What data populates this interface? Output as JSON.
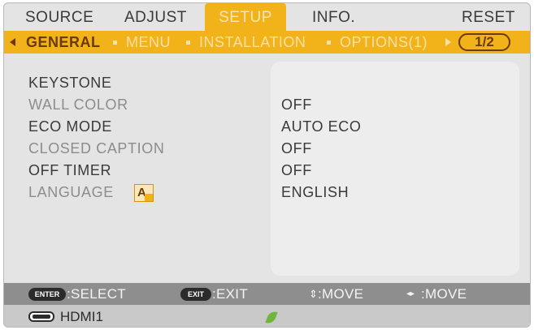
{
  "tabs": [
    {
      "label": "SOURCE"
    },
    {
      "label": "ADJUST"
    },
    {
      "label": "SETUP"
    },
    {
      "label": "INFO."
    },
    {
      "label": "RESET"
    }
  ],
  "active_tab": "SETUP",
  "subtabs": [
    {
      "label": "GENERAL"
    },
    {
      "label": "MENU"
    },
    {
      "label": "INSTALLATION"
    },
    {
      "label": "OPTIONS(1)"
    }
  ],
  "active_subtab": "GENERAL",
  "page_indicator": "1/2",
  "rows": [
    {
      "label": "KEYSTONE",
      "value": ""
    },
    {
      "label": "WALL COLOR",
      "value": "OFF"
    },
    {
      "label": "ECO MODE",
      "value": "AUTO ECO"
    },
    {
      "label": "CLOSED CAPTION",
      "value": "OFF"
    },
    {
      "label": "OFF TIMER",
      "value": "OFF"
    },
    {
      "label": "LANGUAGE",
      "value": "ENGLISH"
    }
  ],
  "help": {
    "enter_key": "ENTER",
    "enter_text": ":SELECT",
    "exit_key": "EXIT",
    "exit_text": ":EXIT",
    "move_v_sym": "⇕",
    "move_v_text": ":MOVE",
    "move_h_sym": "◂▸",
    "move_h_text": ":MOVE"
  },
  "status": {
    "source_icon": "hdmi-connector-icon",
    "source": "HDMI1",
    "eco_icon": "eco-leaf-icon"
  },
  "colors": {
    "accent": "#f2b31a",
    "active_text": "#6a3a00",
    "background": "#e4e4e4"
  }
}
